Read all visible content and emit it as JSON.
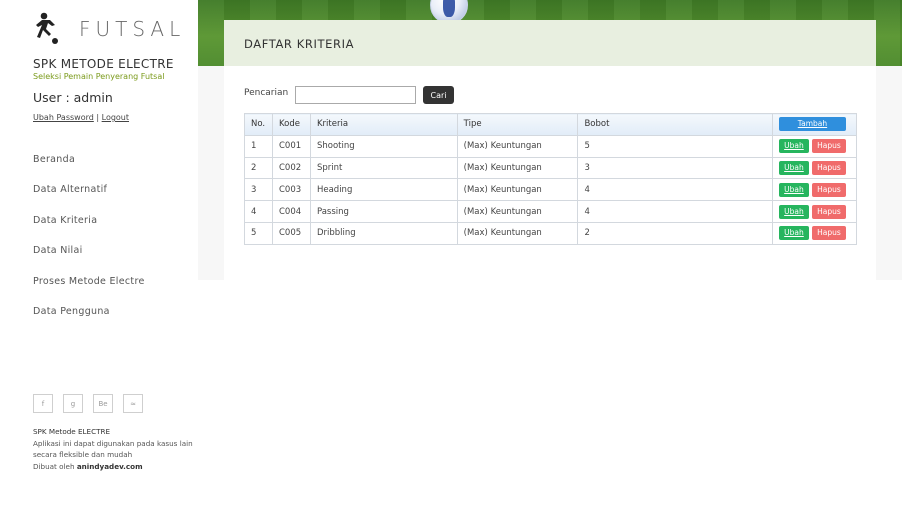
{
  "sidebar": {
    "logo_text": "FUTSAL",
    "app_title": "SPK METODE ELECTRE",
    "app_subtitle": "Seleksi Pemain Penyerang Futsal",
    "user_line": "User : admin",
    "change_password": "Ubah Password",
    "separator": "|",
    "logout": "Logout",
    "nav": [
      {
        "label": "Beranda"
      },
      {
        "label": "Data Alternatif"
      },
      {
        "label": "Data Kriteria"
      },
      {
        "label": "Data Nilai"
      },
      {
        "label": "Proses Metode Electre"
      },
      {
        "label": "Data Pengguna"
      }
    ],
    "social": [
      {
        "glyph": "f",
        "icon": "facebook-icon"
      },
      {
        "glyph": "g",
        "icon": "google-plus-icon"
      },
      {
        "glyph": "Be",
        "icon": "behance-icon"
      },
      {
        "glyph": "≈",
        "icon": "rss-icon"
      }
    ],
    "footer_title": "SPK Metode ELECTRE",
    "footer_text": "Aplikasi ini dapat digunakan pada kasus lain secara fleksible dan mudah",
    "footer_by": "Dibuat oleh",
    "footer_author": "anindyadev.com"
  },
  "main": {
    "title": "DAFTAR KRITERIA",
    "search_label": "Pencarian",
    "search_value": "",
    "search_button": "Cari",
    "table": {
      "headers": [
        "No.",
        "Kode",
        "Kriteria",
        "Tipe",
        "Bobot"
      ],
      "add_button": "Tambah",
      "edit_label": "Ubah",
      "delete_label": "Hapus",
      "rows": [
        [
          "1",
          "C001",
          "Shooting",
          "(Max) Keuntungan",
          "5"
        ],
        [
          "2",
          "C002",
          "Sprint",
          "(Max) Keuntungan",
          "3"
        ],
        [
          "3",
          "C003",
          "Heading",
          "(Max) Keuntungan",
          "4"
        ],
        [
          "4",
          "C004",
          "Passing",
          "(Max) Keuntungan",
          "4"
        ],
        [
          "5",
          "C005",
          "Dribbling",
          "(Max) Keuntungan",
          "2"
        ]
      ]
    }
  },
  "colors": {
    "accent_blue": "#2f8fdd",
    "edit_green": "#26b55e",
    "delete_red": "#f06b6b",
    "subtitle_green": "#7a9a1a"
  }
}
